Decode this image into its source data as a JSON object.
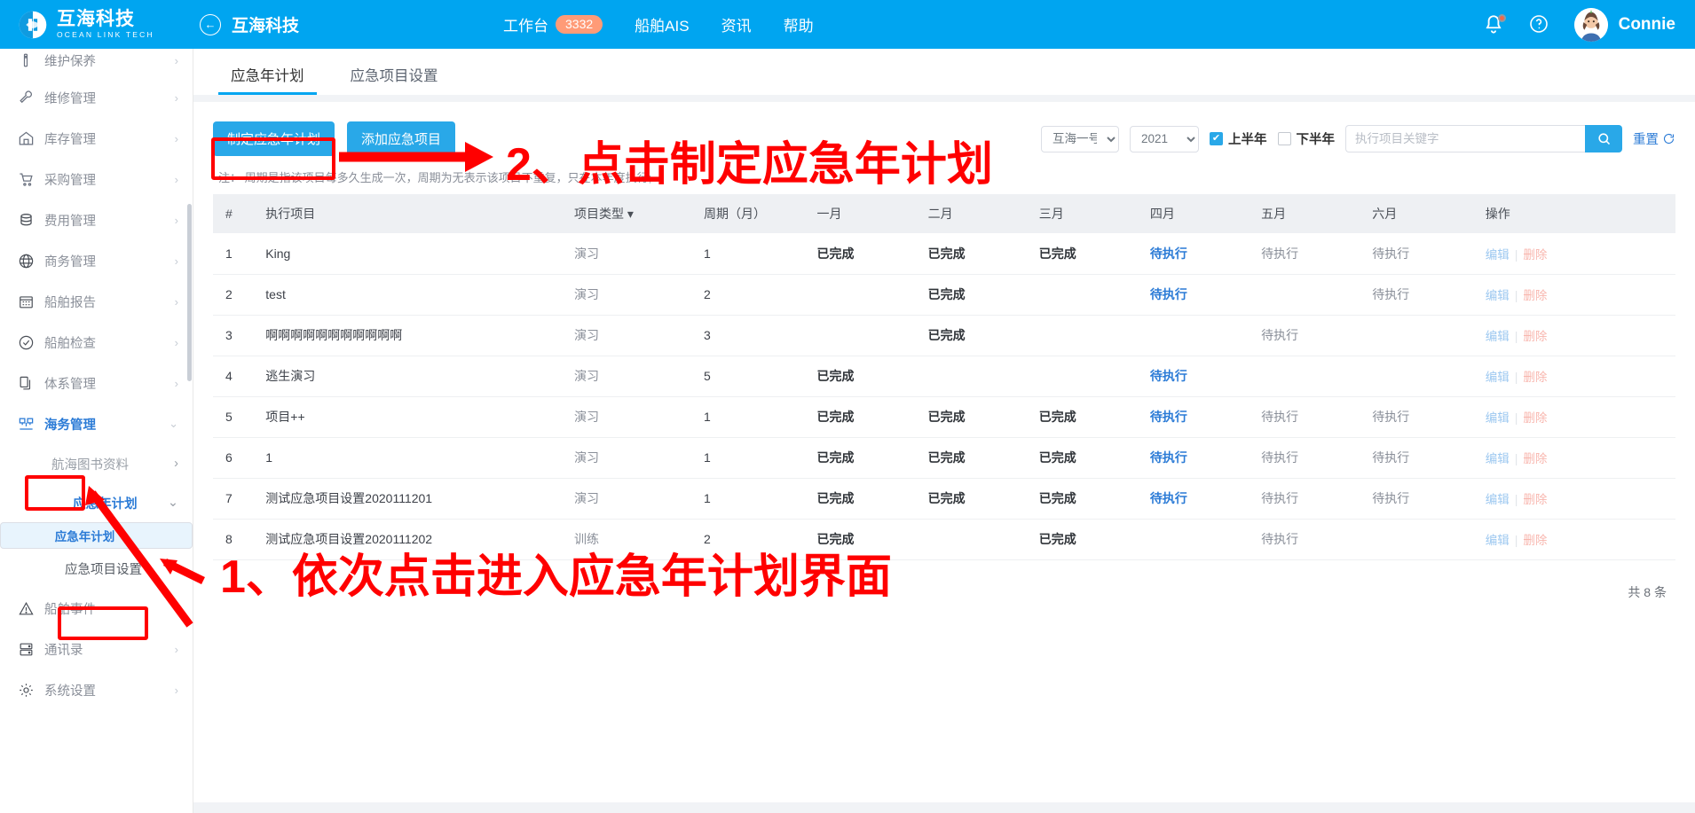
{
  "header": {
    "brand_cn": "互海科技",
    "brand_en": "OCEAN LINK TECH",
    "back_icon": "back-arrow-icon",
    "back_title": "互海科技",
    "nav": [
      {
        "label": "工作台",
        "badge": "3332"
      },
      {
        "label": "船舶AIS",
        "badge": ""
      },
      {
        "label": "资讯",
        "badge": ""
      },
      {
        "label": "帮助",
        "badge": ""
      }
    ],
    "bell_icon": "bell-icon",
    "help_icon": "question-circle-icon",
    "avatar_icon": "avatar",
    "username": "Connie"
  },
  "sidebar": {
    "items": [
      {
        "label": "维护保养",
        "icon": "wrench-tool-icon",
        "chevron": "›",
        "type": "top"
      },
      {
        "label": "维修管理",
        "icon": "wrench-icon",
        "chevron": "›",
        "type": "top"
      },
      {
        "label": "库存管理",
        "icon": "home-icon",
        "chevron": "›",
        "type": "top"
      },
      {
        "label": "采购管理",
        "icon": "cart-icon",
        "chevron": "›",
        "type": "top"
      },
      {
        "label": "费用管理",
        "icon": "database-icon",
        "chevron": "›",
        "type": "top"
      },
      {
        "label": "商务管理",
        "icon": "globe-icon",
        "chevron": "›",
        "type": "top"
      },
      {
        "label": "船舶报告",
        "icon": "calendar-icon",
        "chevron": "›",
        "type": "top"
      },
      {
        "label": "船舶检查",
        "icon": "check-circle-icon",
        "chevron": "›",
        "type": "top"
      },
      {
        "label": "体系管理",
        "icon": "document-copy-icon",
        "chevron": "›",
        "type": "top"
      },
      {
        "label": "海务管理",
        "icon": "sitemap-icon",
        "chevron": "⌄",
        "type": "top-active"
      },
      {
        "label": "航海图书资料",
        "icon": "",
        "chevron": "›",
        "type": "sub"
      },
      {
        "label": "应急年计划",
        "icon": "",
        "chevron": "⌄",
        "type": "sub-blue"
      },
      {
        "label": "应急年计划",
        "icon": "",
        "chevron": "",
        "type": "sub-selected"
      },
      {
        "label": "应急项目设置",
        "icon": "",
        "chevron": "",
        "type": "sub-plain"
      },
      {
        "label": "船舶事件",
        "icon": "warning-triangle-icon",
        "chevron": "",
        "type": "top"
      },
      {
        "label": "通讯录",
        "icon": "contacts-icon",
        "chevron": "›",
        "type": "top"
      },
      {
        "label": "系统设置",
        "icon": "gear-icon",
        "chevron": "›",
        "type": "top"
      }
    ]
  },
  "tabs": [
    {
      "label": "应急年计划",
      "active": true
    },
    {
      "label": "应急项目设置",
      "active": false
    }
  ],
  "toolbar": {
    "create_plan_label": "制定应急年计划",
    "add_item_label": "添加应急项目",
    "vessel_select": "互海一号",
    "year_select": "2021",
    "first_half_label": "上半年",
    "first_half_checked": true,
    "second_half_label": "下半年",
    "second_half_checked": false,
    "search_placeholder": "执行项目关键字",
    "search_value": "",
    "search_icon": "search-icon",
    "reset_label": "重置",
    "reset_icon": "refresh-icon"
  },
  "note": "注： 周期是指该项目每多久生成一次，周期为无表示该项目不重复，只在本年度执行;",
  "table": {
    "columns": [
      "#",
      "执行项目",
      "项目类型 ▾",
      "周期（月）",
      "一月",
      "二月",
      "三月",
      "四月",
      "五月",
      "六月",
      "操作"
    ],
    "rows": [
      {
        "n": "1",
        "name": "King",
        "type": "演习",
        "cycle": "1",
        "months": [
          "已完成",
          "已完成",
          "已完成",
          "待执行",
          "待执行",
          "待执行"
        ],
        "styles": [
          "done",
          "done",
          "done",
          "todo-b",
          "todo-g",
          "todo-g"
        ]
      },
      {
        "n": "2",
        "name": "test",
        "type": "演习",
        "cycle": "2",
        "months": [
          "",
          "已完成",
          "",
          "待执行",
          "",
          "待执行"
        ],
        "styles": [
          "",
          "done",
          "",
          "todo-b",
          "",
          "todo-g"
        ]
      },
      {
        "n": "3",
        "name": "啊啊啊啊啊啊啊啊啊啊啊",
        "type": "演习",
        "cycle": "3",
        "months": [
          "",
          "已完成",
          "",
          "",
          "待执行",
          ""
        ],
        "styles": [
          "",
          "done",
          "",
          "",
          "todo-g",
          ""
        ]
      },
      {
        "n": "4",
        "name": "逃生演习",
        "type": "演习",
        "cycle": "5",
        "months": [
          "已完成",
          "",
          "",
          "待执行",
          "",
          ""
        ],
        "styles": [
          "done",
          "",
          "",
          "todo-b",
          "",
          ""
        ]
      },
      {
        "n": "5",
        "name": "项目++",
        "type": "演习",
        "cycle": "1",
        "months": [
          "已完成",
          "已完成",
          "已完成",
          "待执行",
          "待执行",
          "待执行"
        ],
        "styles": [
          "done",
          "done",
          "done",
          "todo-b",
          "todo-g",
          "todo-g"
        ]
      },
      {
        "n": "6",
        "name": "1",
        "type": "演习",
        "cycle": "1",
        "months": [
          "已完成",
          "已完成",
          "已完成",
          "待执行",
          "待执行",
          "待执行"
        ],
        "styles": [
          "done",
          "done",
          "done",
          "todo-b",
          "todo-g",
          "todo-g"
        ]
      },
      {
        "n": "7",
        "name": "测试应急项目设置2020111201",
        "type": "演习",
        "cycle": "1",
        "months": [
          "已完成",
          "已完成",
          "已完成",
          "待执行",
          "待执行",
          "待执行"
        ],
        "styles": [
          "done",
          "done",
          "done",
          "todo-b",
          "todo-g",
          "todo-g"
        ]
      },
      {
        "n": "8",
        "name": "测试应急项目设置2020111202",
        "type": "训练",
        "cycle": "2",
        "months": [
          "已完成",
          "",
          "已完成",
          "",
          "待执行",
          ""
        ],
        "styles": [
          "done",
          "",
          "done",
          "",
          "todo-g",
          ""
        ]
      }
    ],
    "edit_label": "编辑",
    "delete_label": "删除",
    "separator": "|"
  },
  "footer": {
    "total": "共 8 条"
  },
  "annotations": [
    {
      "id": "step1",
      "text": "1、依次点击进入应急年计划界面"
    },
    {
      "id": "step2",
      "text": "2、点击制定应急年计划"
    }
  ],
  "colors": {
    "brand_blue": "#00A5F0",
    "button_blue": "#29A8E8",
    "link_blue": "#2B7BD6",
    "annotation_red": "#FF0000",
    "badge_orange": "#FF9B77"
  }
}
